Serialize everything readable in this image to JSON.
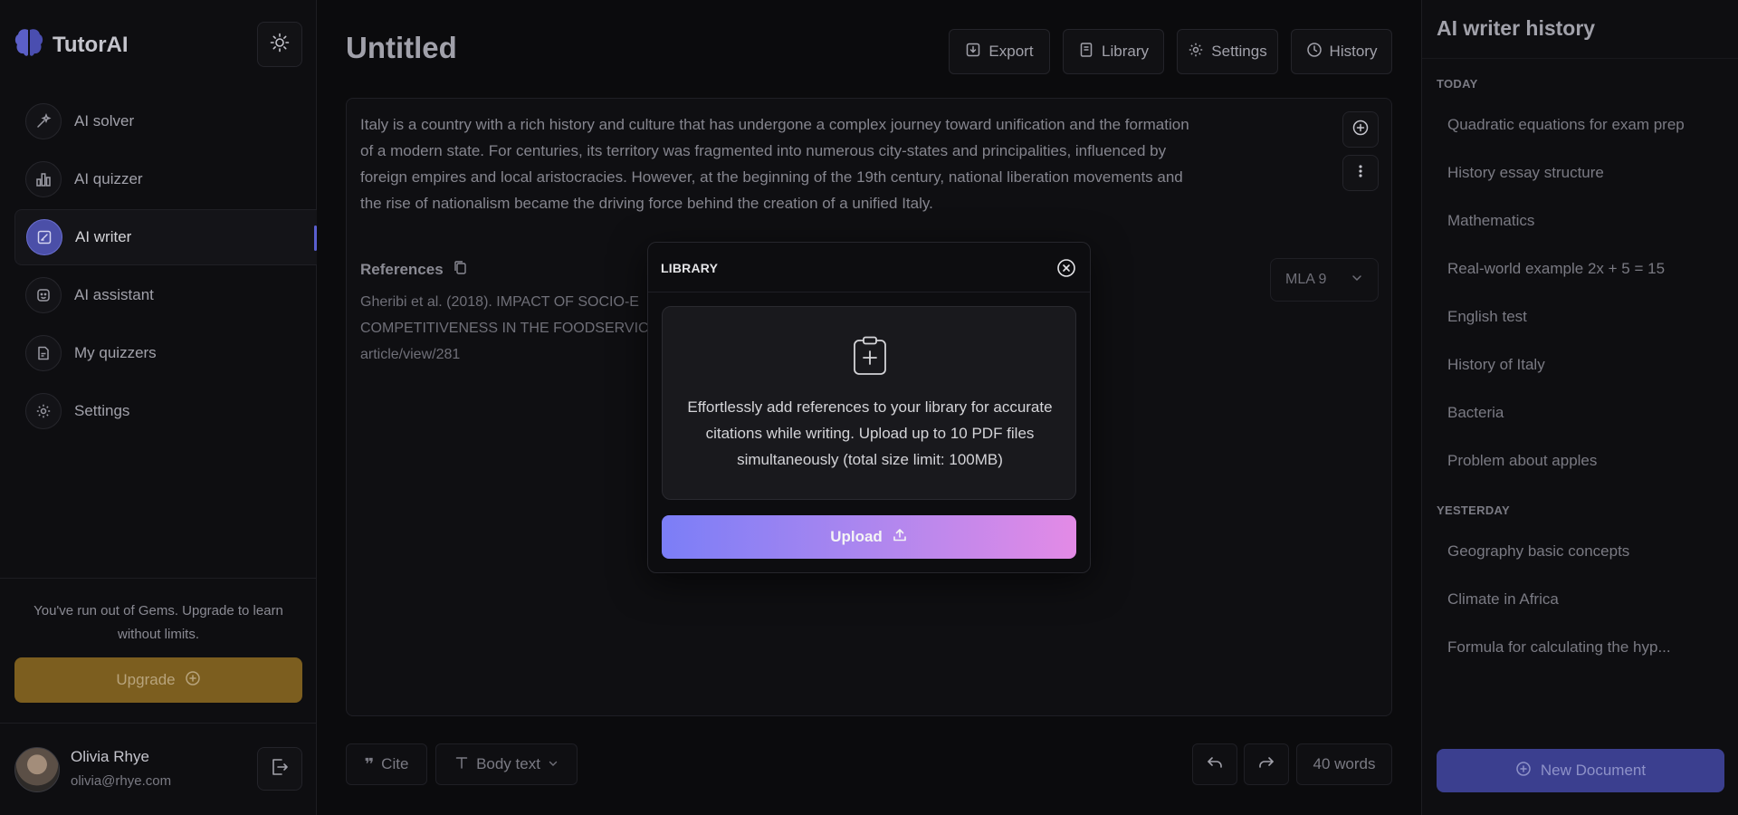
{
  "brand": {
    "name": "TutorAI"
  },
  "sidebar": {
    "items": [
      {
        "label": "AI solver"
      },
      {
        "label": "AI quizzer"
      },
      {
        "label": "AI writer"
      },
      {
        "label": "AI assistant"
      },
      {
        "label": "My quizzers"
      },
      {
        "label": "Settings"
      }
    ],
    "gems_message": "You've run out of Gems. Upgrade to learn without limits.",
    "upgrade_label": "Upgrade",
    "user": {
      "name": "Olivia Rhye",
      "email": "olivia@rhye.com"
    }
  },
  "document": {
    "title": "Untitled",
    "body": "Italy is a country with a rich history and culture that has undergone a complex journey toward unification and the formation of a modern state. For centuries, its territory was fragmented into numerous city-states and principalities, influenced by foreign empires and local aristocracies. However, at the beginning of the 19th century, national liberation movements and the rise of nationalism became the driving force behind the creation of a unified Italy.",
    "references_label": "References",
    "reference_lines": [
      "Gheribi et al. (2018). IMPACT OF SOCIO-E",
      "COMPETITIVENESS IN THE FOODSERVICE IN",
      "article/view/281"
    ],
    "citation_style": "MLA 9"
  },
  "toolbar": {
    "export_label": "Export",
    "library_label": "Library",
    "settings_label": "Settings",
    "history_label": "History"
  },
  "bottom_bar": {
    "cite_label": "Cite",
    "text_style": "Body text",
    "word_count": "40 words"
  },
  "history": {
    "title": "AI writer history",
    "today_label": "TODAY",
    "today": [
      "Quadratic equations for exam prep",
      "History essay structure",
      "Mathematics",
      "Real-world example 2x + 5 = 15",
      "English test",
      "History of Italy",
      "Bacteria",
      "Problem about apples"
    ],
    "yesterday_label": "YESTERDAY",
    "yesterday": [
      "Geography basic concepts",
      "Climate in Africa",
      "Formula for calculating the hyp..."
    ],
    "new_document_label": "New Document"
  },
  "modal": {
    "title": "LIBRARY",
    "description": "Effortlessly add references to your library for accurate citations while writing. Upload up to 10 PDF files simultaneously (total size limit: 100MB)",
    "upload_label": "Upload"
  },
  "colors": {
    "accent": "#5a5fcf",
    "upgrade": "#7c5e1f",
    "new_document": "#3b3f8f",
    "upload_gradient_start": "#7b7ef7",
    "upload_gradient_end": "#e38ae6"
  },
  "icons": {
    "brand": "brain-icon",
    "theme": "sun-icon",
    "nav": [
      "sparkle-tool-icon",
      "bar-chart-icon",
      "edit-document-icon",
      "robot-face-icon",
      "quiz-file-icon",
      "gear-icon"
    ],
    "logout": "logout-icon",
    "export": "download-icon",
    "library": "book-icon",
    "settings": "gear-icon",
    "history": "clock-icon",
    "copy": "copy-icon",
    "cite": "quote-icon",
    "text_style": "text-type-icon",
    "undo": "undo-icon",
    "redo": "redo-icon",
    "dropzone": "clipboard-add-icon",
    "upload": "upload-icon",
    "close": "close-circle-icon"
  }
}
